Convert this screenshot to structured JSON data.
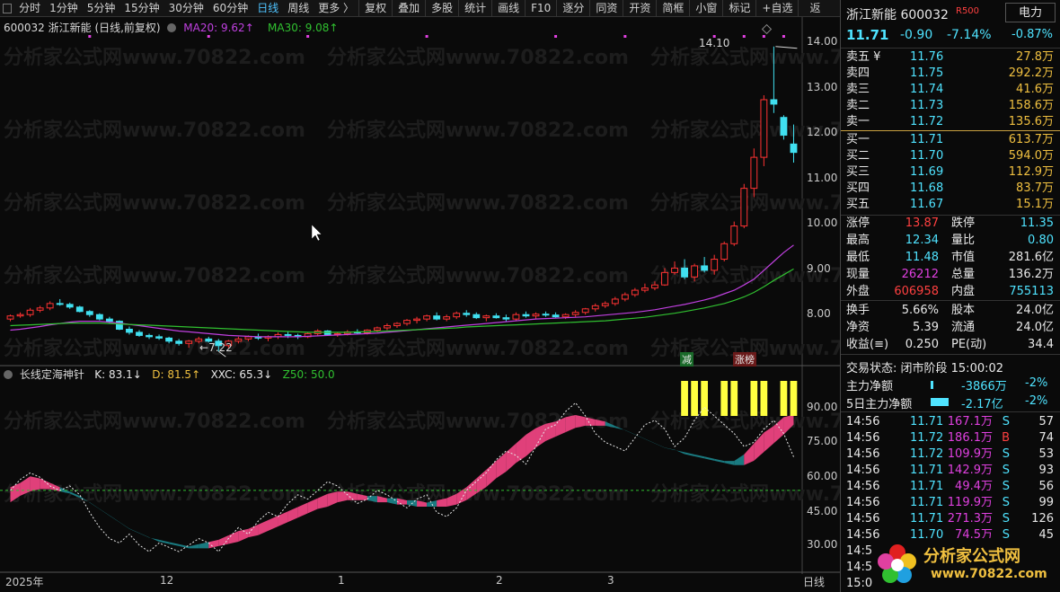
{
  "toolbar": {
    "items": [
      "分时",
      "1分钟",
      "5分钟",
      "15分钟",
      "30分钟",
      "60分钟",
      "日线",
      "周线",
      "更多 〉"
    ],
    "active_index": 6,
    "groups": [
      "复权",
      "叠加",
      "多股",
      "统计",
      "画线",
      "F10",
      "逐分",
      "同资",
      "开资",
      "简框",
      "小窗",
      "标记",
      "+自选"
    ],
    "back": "返回"
  },
  "chart_header": {
    "code_name": "600032 浙江新能 (日线,前复权)",
    "ma20": "MA20: 9.62↑",
    "ma30": "MA30: 9.08↑",
    "high_label": "14.10",
    "low_label": "7.22",
    "tag_jian": "减",
    "tag_zhangbang": "涨榜"
  },
  "price_axis": [
    "14.00",
    "13.00",
    "12.00",
    "11.00",
    "10.00",
    "9.00",
    "8.00"
  ],
  "indicator_header": {
    "name": "长线定海神针",
    "k": "K: 83.1↓",
    "d": "D: 81.5↑",
    "xxc": "XXC: 65.3↓",
    "z50": "Z50: 50.0"
  },
  "indicator_axis": [
    "90.00",
    "75.00",
    "60.00",
    "45.00",
    "30.00"
  ],
  "date_axis": [
    "2025年",
    "12",
    "1",
    "2",
    "3"
  ],
  "period_label": "日线",
  "watermark": "分析家公式网www.70822.com",
  "colors": {
    "up": "#ff3333",
    "down": "#40e0f0",
    "ma20": "#c040e0",
    "ma30": "#30c030",
    "pink": "#e0407a",
    "teal": "#1a7a80",
    "yellow": "#ffff40"
  },
  "chart_data": {
    "type": "candlestick",
    "x_unit": "trading day",
    "ylim": [
      7.0,
      14.4
    ],
    "candles": [
      [
        7.95,
        8.05,
        7.9,
        8.02
      ],
      [
        8.02,
        8.1,
        7.98,
        8.05
      ],
      [
        8.05,
        8.2,
        8.0,
        8.15
      ],
      [
        8.15,
        8.25,
        8.1,
        8.2
      ],
      [
        8.2,
        8.35,
        8.15,
        8.3
      ],
      [
        8.3,
        8.4,
        8.25,
        8.28
      ],
      [
        8.28,
        8.32,
        8.18,
        8.22
      ],
      [
        8.22,
        8.25,
        8.1,
        8.12
      ],
      [
        8.12,
        8.15,
        8.0,
        8.05
      ],
      [
        8.05,
        8.08,
        7.92,
        7.95
      ],
      [
        7.95,
        8.0,
        7.85,
        7.9
      ],
      [
        7.9,
        7.92,
        7.7,
        7.72
      ],
      [
        7.72,
        7.78,
        7.6,
        7.65
      ],
      [
        7.65,
        7.7,
        7.55,
        7.58
      ],
      [
        7.58,
        7.62,
        7.5,
        7.55
      ],
      [
        7.55,
        7.6,
        7.48,
        7.52
      ],
      [
        7.52,
        7.55,
        7.4,
        7.45
      ],
      [
        7.45,
        7.5,
        7.35,
        7.4
      ],
      [
        7.4,
        7.48,
        7.3,
        7.45
      ],
      [
        7.45,
        7.55,
        7.4,
        7.5
      ],
      [
        7.5,
        7.55,
        7.42,
        7.45
      ],
      [
        7.45,
        7.5,
        7.22,
        7.35
      ],
      [
        7.35,
        7.48,
        7.3,
        7.45
      ],
      [
        7.45,
        7.55,
        7.4,
        7.5
      ],
      [
        7.5,
        7.58,
        7.45,
        7.55
      ],
      [
        7.55,
        7.62,
        7.48,
        7.52
      ],
      [
        7.52,
        7.58,
        7.45,
        7.55
      ],
      [
        7.55,
        7.65,
        7.5,
        7.6
      ],
      [
        7.6,
        7.68,
        7.52,
        7.58
      ],
      [
        7.58,
        7.62,
        7.5,
        7.55
      ],
      [
        7.55,
        7.65,
        7.52,
        7.62
      ],
      [
        7.62,
        7.72,
        7.58,
        7.68
      ],
      [
        7.68,
        7.7,
        7.58,
        7.6
      ],
      [
        7.6,
        7.66,
        7.55,
        7.62
      ],
      [
        7.62,
        7.7,
        7.58,
        7.66
      ],
      [
        7.66,
        7.72,
        7.6,
        7.64
      ],
      [
        7.64,
        7.72,
        7.6,
        7.7
      ],
      [
        7.7,
        7.78,
        7.65,
        7.75
      ],
      [
        7.75,
        7.85,
        7.7,
        7.8
      ],
      [
        7.8,
        7.88,
        7.75,
        7.85
      ],
      [
        7.85,
        7.95,
        7.8,
        7.92
      ],
      [
        7.92,
        8.0,
        7.85,
        7.95
      ],
      [
        7.95,
        8.05,
        7.9,
        8.02
      ],
      [
        8.02,
        8.1,
        7.92,
        7.95
      ],
      [
        7.95,
        8.05,
        7.9,
        8.0
      ],
      [
        8.0,
        8.12,
        7.95,
        8.08
      ],
      [
        8.08,
        8.15,
        8.0,
        8.05
      ],
      [
        8.05,
        8.1,
        7.95,
        7.98
      ],
      [
        7.98,
        8.05,
        7.9,
        8.02
      ],
      [
        8.02,
        8.08,
        7.96,
        7.98
      ],
      [
        7.98,
        8.05,
        7.9,
        7.95
      ],
      [
        7.95,
        8.1,
        7.92,
        8.05
      ],
      [
        8.05,
        8.12,
        7.98,
        8.02
      ],
      [
        8.02,
        8.1,
        7.96,
        8.06
      ],
      [
        8.06,
        8.12,
        8.0,
        8.04
      ],
      [
        8.04,
        8.1,
        7.98,
        8.0
      ],
      [
        8.0,
        8.08,
        7.95,
        8.05
      ],
      [
        8.05,
        8.15,
        8.0,
        8.1
      ],
      [
        8.1,
        8.2,
        8.05,
        8.18
      ],
      [
        8.18,
        8.3,
        8.12,
        8.25
      ],
      [
        8.25,
        8.35,
        8.2,
        8.3
      ],
      [
        8.3,
        8.45,
        8.25,
        8.4
      ],
      [
        8.4,
        8.55,
        8.35,
        8.5
      ],
      [
        8.5,
        8.65,
        8.45,
        8.6
      ],
      [
        8.6,
        8.75,
        8.55,
        8.65
      ],
      [
        8.65,
        8.8,
        8.6,
        8.72
      ],
      [
        8.72,
        9.1,
        8.7,
        9.0
      ],
      [
        9.0,
        9.25,
        8.95,
        9.1
      ],
      [
        9.1,
        9.3,
        8.85,
        8.9
      ],
      [
        8.9,
        9.2,
        8.8,
        9.15
      ],
      [
        9.15,
        9.35,
        9.0,
        9.05
      ],
      [
        9.05,
        9.4,
        8.95,
        9.3
      ],
      [
        9.3,
        9.7,
        9.25,
        9.65
      ],
      [
        9.65,
        10.15,
        9.6,
        10.05
      ],
      [
        10.05,
        11.0,
        10.0,
        10.9
      ],
      [
        10.9,
        11.8,
        10.7,
        11.6
      ],
      [
        11.6,
        13.0,
        11.4,
        12.9
      ],
      [
        12.9,
        14.1,
        12.6,
        12.8
      ],
      [
        12.5,
        12.55,
        12.0,
        12.1
      ],
      [
        11.9,
        12.34,
        11.48,
        11.71
      ]
    ],
    "ma20": [
      7.7,
      7.72,
      7.75,
      7.78,
      7.82,
      7.85,
      7.88,
      7.9,
      7.9,
      7.9,
      7.88,
      7.86,
      7.83,
      7.8,
      7.77,
      7.74,
      7.71,
      7.68,
      7.66,
      7.64,
      7.62,
      7.6,
      7.58,
      7.57,
      7.56,
      7.55,
      7.55,
      7.55,
      7.55,
      7.55,
      7.56,
      7.57,
      7.58,
      7.59,
      7.6,
      7.61,
      7.62,
      7.63,
      7.65,
      7.67,
      7.69,
      7.71,
      7.73,
      7.75,
      7.77,
      7.79,
      7.81,
      7.83,
      7.85,
      7.87,
      7.89,
      7.91,
      7.93,
      7.95,
      7.96,
      7.97,
      7.98,
      7.99,
      8.0,
      8.02,
      8.04,
      8.06,
      8.08,
      8.1,
      8.13,
      8.16,
      8.2,
      8.24,
      8.28,
      8.33,
      8.38,
      8.44,
      8.52,
      8.6,
      8.72,
      8.85,
      9.05,
      9.25,
      9.45,
      9.62
    ],
    "ma30": [
      7.8,
      7.81,
      7.82,
      7.83,
      7.84,
      7.85,
      7.86,
      7.86,
      7.86,
      7.86,
      7.85,
      7.84,
      7.83,
      7.82,
      7.81,
      7.8,
      7.79,
      7.78,
      7.77,
      7.76,
      7.75,
      7.74,
      7.73,
      7.72,
      7.71,
      7.7,
      7.69,
      7.68,
      7.67,
      7.66,
      7.65,
      7.65,
      7.65,
      7.65,
      7.65,
      7.66,
      7.66,
      7.67,
      7.68,
      7.69,
      7.7,
      7.71,
      7.72,
      7.73,
      7.74,
      7.75,
      7.77,
      7.78,
      7.79,
      7.8,
      7.81,
      7.82,
      7.83,
      7.84,
      7.85,
      7.86,
      7.87,
      7.88,
      7.89,
      7.9,
      7.91,
      7.93,
      7.95,
      7.97,
      7.99,
      8.02,
      8.05,
      8.08,
      8.12,
      8.16,
      8.2,
      8.25,
      8.3,
      8.37,
      8.45,
      8.55,
      8.68,
      8.82,
      8.95,
      9.08
    ],
    "indicator": {
      "ylim": [
        20,
        100
      ],
      "K": [
        50,
        52,
        55,
        54,
        52,
        50,
        48,
        46,
        43,
        40,
        37,
        34,
        31,
        29,
        27,
        26,
        25,
        24,
        23,
        24,
        25,
        26,
        28,
        30,
        31,
        33,
        35,
        37,
        39,
        41,
        43,
        45,
        47,
        48,
        48,
        47,
        46,
        46,
        45,
        45,
        44,
        44,
        43,
        44,
        45,
        47,
        50,
        54,
        58,
        62,
        66,
        70,
        74,
        77,
        79,
        80,
        82,
        83,
        82,
        81,
        80,
        78,
        76,
        74,
        72,
        70,
        68,
        67,
        66,
        65,
        64,
        63,
        62,
        62,
        65,
        70,
        75,
        78,
        82,
        83.1
      ],
      "D": [
        46,
        49,
        51,
        52,
        52,
        51,
        50,
        48,
        46,
        43,
        40,
        37,
        34,
        32,
        30,
        28,
        27,
        26,
        25,
        25,
        25,
        26,
        27,
        28,
        30,
        31,
        33,
        35,
        37,
        39,
        41,
        43,
        44,
        46,
        47,
        47,
        47,
        46,
        46,
        45,
        45,
        44,
        44,
        44,
        44,
        45,
        47,
        50,
        53,
        57,
        60,
        64,
        67,
        71,
        74,
        76,
        78,
        80,
        81,
        81,
        81,
        80,
        79,
        77,
        75,
        73,
        71,
        70,
        68,
        67,
        66,
        65,
        64,
        63,
        63,
        65,
        69,
        73,
        77,
        81.5
      ],
      "XXC": [
        50,
        55,
        58,
        56,
        52,
        50,
        52,
        48,
        40,
        33,
        28,
        26,
        30,
        25,
        22,
        26,
        24,
        22,
        25,
        28,
        26,
        22,
        28,
        33,
        30,
        36,
        40,
        38,
        44,
        48,
        46,
        50,
        54,
        52,
        48,
        44,
        46,
        50,
        48,
        45,
        42,
        46,
        48,
        40,
        38,
        42,
        50,
        54,
        58,
        64,
        68,
        66,
        62,
        70,
        78,
        80,
        86,
        90,
        84,
        76,
        72,
        70,
        68,
        74,
        80,
        82,
        78,
        70,
        74,
        82,
        88,
        84,
        80,
        76,
        70,
        72,
        78,
        82,
        76,
        65.3
      ],
      "Z50": 50,
      "yellow_bars_last": 12
    }
  },
  "panel": {
    "title": "浙江新能 600032",
    "r_badge": "R500",
    "sector_button": "电力",
    "price": "11.71",
    "change": "-0.90",
    "change_pct": "-7.14%",
    "sector_pct": "-0.87%",
    "asks": [
      {
        "label": "卖五 ¥",
        "price": "11.76",
        "vol": "27.8万"
      },
      {
        "label": "卖四",
        "price": "11.75",
        "vol": "292.2万"
      },
      {
        "label": "卖三",
        "price": "11.74",
        "vol": "41.6万"
      },
      {
        "label": "卖二",
        "price": "11.73",
        "vol": "158.6万"
      },
      {
        "label": "卖一",
        "price": "11.72",
        "vol": "135.6万"
      }
    ],
    "bids": [
      {
        "label": "买一",
        "price": "11.71",
        "vol": "613.7万"
      },
      {
        "label": "买二",
        "price": "11.70",
        "vol": "594.0万"
      },
      {
        "label": "买三",
        "price": "11.69",
        "vol": "112.9万"
      },
      {
        "label": "买四",
        "price": "11.68",
        "vol": "83.7万"
      },
      {
        "label": "买五",
        "price": "11.67",
        "vol": "15.1万"
      }
    ],
    "stats": [
      [
        "涨停",
        "13.87",
        "跌停",
        "11.35"
      ],
      [
        "最高",
        "12.34",
        "量比",
        "0.80"
      ],
      [
        "最低",
        "11.48",
        "市值",
        "281.6亿"
      ],
      [
        "现量",
        "26212",
        "总量",
        "136.2万"
      ],
      [
        "外盘",
        "606958",
        "内盘",
        "755113"
      ]
    ],
    "stats2": [
      [
        "换手",
        "5.66%",
        "股本",
        "24.0亿"
      ],
      [
        "净资",
        "5.39",
        "流通",
        "24.0亿"
      ],
      [
        "收益(≡)",
        "0.250",
        "PE(动)",
        "34.4"
      ]
    ],
    "trade_status": "交易状态: 闭市阶段 15:00:02",
    "main_flow_label": "主力净额",
    "main_flow_value": "-3866万",
    "main_flow_pct": "-2%",
    "main5_label": "5日主力净额",
    "main5_value": "-2.17亿",
    "main5_pct": "-2%",
    "ticks": [
      [
        "14:56",
        "11.71",
        "167.1万",
        "S",
        "57"
      ],
      [
        "14:56",
        "11.72",
        "186.1万",
        "B",
        "74"
      ],
      [
        "14:56",
        "11.72",
        "109.9万",
        "S",
        "53"
      ],
      [
        "14:56",
        "11.71",
        "142.9万",
        "S",
        "93"
      ],
      [
        "14:56",
        "11.71",
        "49.4万",
        "S",
        "56"
      ],
      [
        "14:56",
        "11.71",
        "119.9万",
        "S",
        "99"
      ],
      [
        "14:56",
        "11.71",
        "271.3万",
        "S",
        "126"
      ],
      [
        "14:56",
        "11.70",
        "74.5万",
        "S",
        "45"
      ],
      [
        "14:5",
        "",
        "",
        "",
        ""
      ],
      [
        "14:5",
        "",
        "",
        "",
        ""
      ],
      [
        "15:0",
        "",
        "",
        "",
        ""
      ]
    ],
    "logo_text": "分析家公式网",
    "logo_url": "www.70822.com"
  }
}
